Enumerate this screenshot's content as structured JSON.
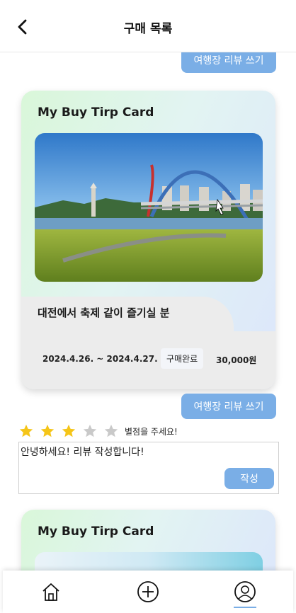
{
  "header": {
    "title": "구매 목록"
  },
  "top_review_button": {
    "label": "여행장 리뷰 쓰기"
  },
  "card": {
    "title": "My Buy Tirp Card",
    "subtitle": "대전에서 축제 같이 즐기실 분",
    "dates": "2024.4.26. ~ 2024.4.27.",
    "status": "구매완료",
    "price": "30,000원"
  },
  "review_button": {
    "label": "여행장 리뷰 쓰기"
  },
  "rating": {
    "value": 3,
    "max": 5,
    "hint": "별점을 주세요!"
  },
  "review": {
    "text": "안녕하세요! 리뷰 작성합니다!",
    "submit_label": "작성"
  },
  "next_card": {
    "title": "My Buy Tirp Card"
  },
  "colors": {
    "accent": "#7aaee6",
    "star_filled": "#f5c518",
    "star_empty": "#c9c9c9"
  },
  "nav": {
    "items": [
      "home-icon",
      "add-icon",
      "profile-icon"
    ],
    "active": "profile-icon"
  }
}
